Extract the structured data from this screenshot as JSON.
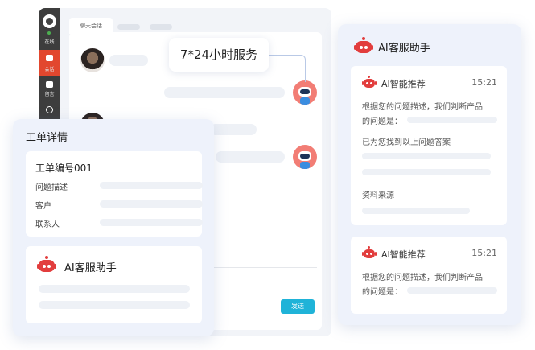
{
  "app": {
    "rail": {
      "status_label": "在线",
      "active_item_label": "会话",
      "messages_label": "留言"
    },
    "tab_label": "聊天会话",
    "send_label": "发送"
  },
  "callout": {
    "text": "7*24小时服务"
  },
  "work_order": {
    "title": "工单详情",
    "number": "工单编号001",
    "fields": [
      {
        "label": "问题描述"
      },
      {
        "label": "客户"
      },
      {
        "label": "联系人"
      }
    ],
    "assistant_title": "AI客服助手"
  },
  "ai_panel": {
    "title": "AI客服助手",
    "cards": [
      {
        "title": "AI智能推荐",
        "time": "15:21",
        "line1": "根据您的问题描述，我们判断产品",
        "line2": "的问题是：",
        "found": "已为您找到以上问题答案",
        "source": "资料来源"
      },
      {
        "title": "AI智能推荐",
        "time": "15:21",
        "line1": "根据您的问题描述，我们判断产品",
        "line2": "的问题是："
      }
    ]
  },
  "colors": {
    "accent_red": "#e23d3d",
    "send_button": "#1fb3d8",
    "rail_active": "#e2472e"
  }
}
